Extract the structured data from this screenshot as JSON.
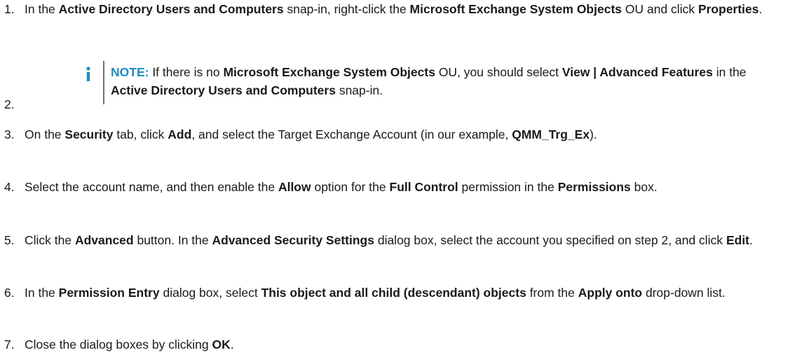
{
  "steps": [
    {
      "number": "1.",
      "segments": [
        {
          "t": "In the ",
          "b": false
        },
        {
          "t": "Active Directory Users and Computers",
          "b": true
        },
        {
          "t": " snap-in, right-click the ",
          "b": false
        },
        {
          "t": "Microsoft Exchange System Objects",
          "b": true
        },
        {
          "t": " OU and click ",
          "b": false
        },
        {
          "t": "Properties",
          "b": true
        },
        {
          "t": ".",
          "b": false
        }
      ]
    },
    {
      "number": "2.",
      "note": {
        "icon": "info-icon",
        "label": "NOTE:",
        "segments": [
          {
            "t": " If there is no ",
            "b": false
          },
          {
            "t": "Microsoft Exchange System Objects",
            "b": true
          },
          {
            "t": " OU, you should select ",
            "b": false
          },
          {
            "t": "View | Advanced Features",
            "b": true
          },
          {
            "t": " in the ",
            "b": false
          },
          {
            "t": "Active Directory Users and Computers",
            "b": true
          },
          {
            "t": " snap-in.",
            "b": false
          }
        ]
      }
    },
    {
      "number": "3.",
      "segments": [
        {
          "t": "On the ",
          "b": false
        },
        {
          "t": "Security",
          "b": true
        },
        {
          "t": " tab, click ",
          "b": false
        },
        {
          "t": "Add",
          "b": true
        },
        {
          "t": ", and select the Target Exchange Account (in our example, ",
          "b": false
        },
        {
          "t": "QMM_Trg_Ex",
          "b": true
        },
        {
          "t": ").",
          "b": false
        }
      ]
    },
    {
      "number": "4.",
      "segments": [
        {
          "t": "Select the account name, and then enable the ",
          "b": false
        },
        {
          "t": "Allow",
          "b": true
        },
        {
          "t": " option for the ",
          "b": false
        },
        {
          "t": "Full Control",
          "b": true
        },
        {
          "t": " permission in the ",
          "b": false
        },
        {
          "t": "Permissions",
          "b": true
        },
        {
          "t": " box.",
          "b": false
        }
      ]
    },
    {
      "number": "5.",
      "segments": [
        {
          "t": "Click the ",
          "b": false
        },
        {
          "t": "Advanced",
          "b": true
        },
        {
          "t": " button. In the ",
          "b": false
        },
        {
          "t": "Advanced Security Settings",
          "b": true
        },
        {
          "t": " dialog box, select the account you specified on step 2, and click ",
          "b": false
        },
        {
          "t": "Edit",
          "b": true
        },
        {
          "t": ".",
          "b": false
        }
      ]
    },
    {
      "number": "6.",
      "segments": [
        {
          "t": "In the ",
          "b": false
        },
        {
          "t": "Permission Entry",
          "b": true
        },
        {
          "t": " dialog box, select ",
          "b": false
        },
        {
          "t": "This object and all child (descendant) objects",
          "b": true
        },
        {
          "t": " from the ",
          "b": false
        },
        {
          "t": "Apply onto",
          "b": true
        },
        {
          "t": " drop-down list.",
          "b": false
        }
      ]
    },
    {
      "number": "7.",
      "segments": [
        {
          "t": "Close the dialog boxes by clicking ",
          "b": false
        },
        {
          "t": "OK",
          "b": true
        },
        {
          "t": ".",
          "b": false
        }
      ]
    }
  ],
  "colors": {
    "note_accent": "#1f8bc0",
    "rule": "#6f7174",
    "text": "#1a1a1a"
  }
}
